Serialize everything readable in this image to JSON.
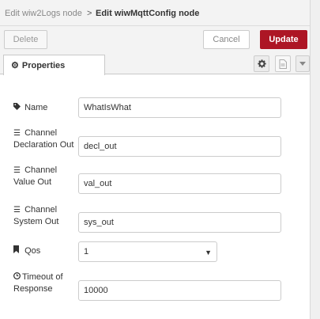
{
  "breadcrumb": {
    "previous": "Edit wiw2Logs node",
    "separator": ">",
    "current": "Edit wiwMqttConfig node"
  },
  "toolbar": {
    "delete_label": "Delete",
    "cancel_label": "Cancel",
    "update_label": "Update"
  },
  "tabs": {
    "properties_label": "Properties",
    "settings_icon": "gear-icon",
    "description_icon": "file-text-icon",
    "more_icon": "caret-down-icon"
  },
  "form": {
    "name": {
      "label": "Name",
      "icon": "tag-icon",
      "value": "WhatIsWhat"
    },
    "decl_out": {
      "label_line1": "Channel",
      "label_line2": "Declaration Out",
      "icon": "list-icon",
      "value": "decl_out"
    },
    "val_out": {
      "label_line1": "Channel",
      "label_line2": "Value Out",
      "icon": "list-icon",
      "value": "val_out"
    },
    "sys_out": {
      "label_line1": "Channel",
      "label_line2": "System Out",
      "icon": "list-icon",
      "value": "sys_out"
    },
    "qos": {
      "label": "Qos",
      "icon": "bookmark-icon",
      "value": "1"
    },
    "timeout": {
      "label_line1": "Timeout of",
      "label_line2": "Response",
      "icon": "clock-icon",
      "value": "10000"
    }
  },
  "colors": {
    "update_button": "#ad1625",
    "panel_background": "#f3f3f3"
  }
}
